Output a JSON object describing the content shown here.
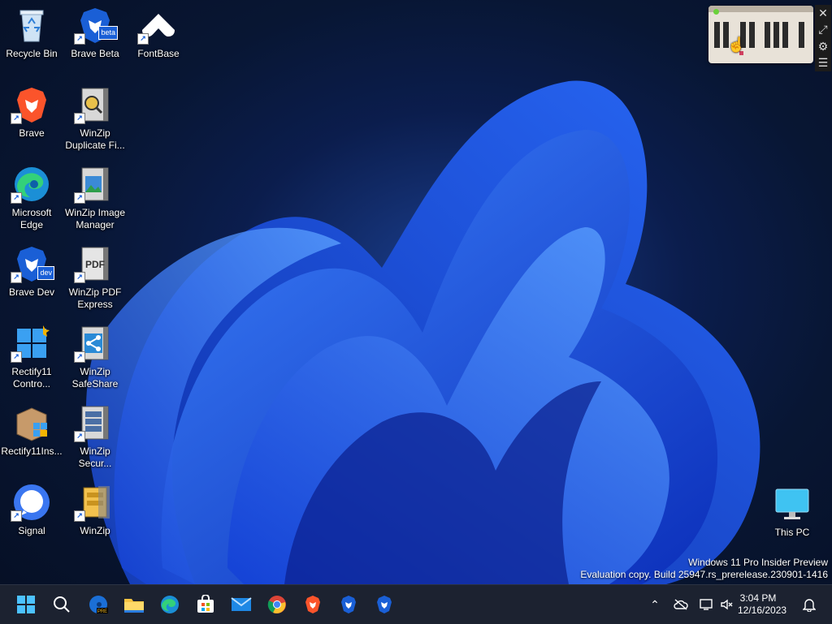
{
  "desktop": {
    "icons": [
      {
        "label": "Recycle Bin",
        "icon": "recycle-bin-icon"
      },
      {
        "label": "Brave Beta",
        "icon": "brave-beta-icon",
        "badge": "beta"
      },
      {
        "label": "FontBase",
        "icon": "fontbase-icon"
      },
      {
        "label": "Brave",
        "icon": "brave-icon"
      },
      {
        "label": "WinZip Duplicate Fi...",
        "icon": "winzip-duplicate-finder-icon"
      },
      {
        "label": "Microsoft Edge",
        "icon": "edge-icon"
      },
      {
        "label": "WinZip Image Manager",
        "icon": "winzip-image-manager-icon"
      },
      {
        "label": "Brave Dev",
        "icon": "brave-dev-icon",
        "badge": "dev"
      },
      {
        "label": "WinZip PDF Express",
        "icon": "winzip-pdf-express-icon",
        "badge": "PDF"
      },
      {
        "label": "Rectify11 Contro...",
        "icon": "rectify11-control-icon"
      },
      {
        "label": "WinZip SafeShare",
        "icon": "winzip-safeshare-icon"
      },
      {
        "label": "Rectify11Ins...",
        "icon": "rectify11-installer-icon"
      },
      {
        "label": "WinZip Secur...",
        "icon": "winzip-secure-backup-icon"
      },
      {
        "label": "Signal",
        "icon": "signal-icon"
      },
      {
        "label": "WinZip",
        "icon": "winzip-icon"
      },
      {
        "label": "This PC",
        "icon": "this-pc-icon"
      }
    ]
  },
  "watermark": {
    "line1": "Windows 11 Pro Insider Preview",
    "line2": "Evaluation copy. Build 25947.rs_prerelease.230901-1416"
  },
  "taskbar": {
    "apps": [
      "start-icon",
      "search-icon",
      "edge-beta-icon",
      "file-explorer-icon",
      "edge-icon",
      "microsoft-store-icon",
      "mail-icon",
      "chrome-icon",
      "brave-icon",
      "brave-beta-icon",
      "brave-dev-icon"
    ],
    "time": "3:04 PM",
    "date": "12/16/2023"
  },
  "colors": {
    "accent": "#1a5fd6",
    "taskbar": "#1c2230",
    "brave": "#fb542b"
  }
}
